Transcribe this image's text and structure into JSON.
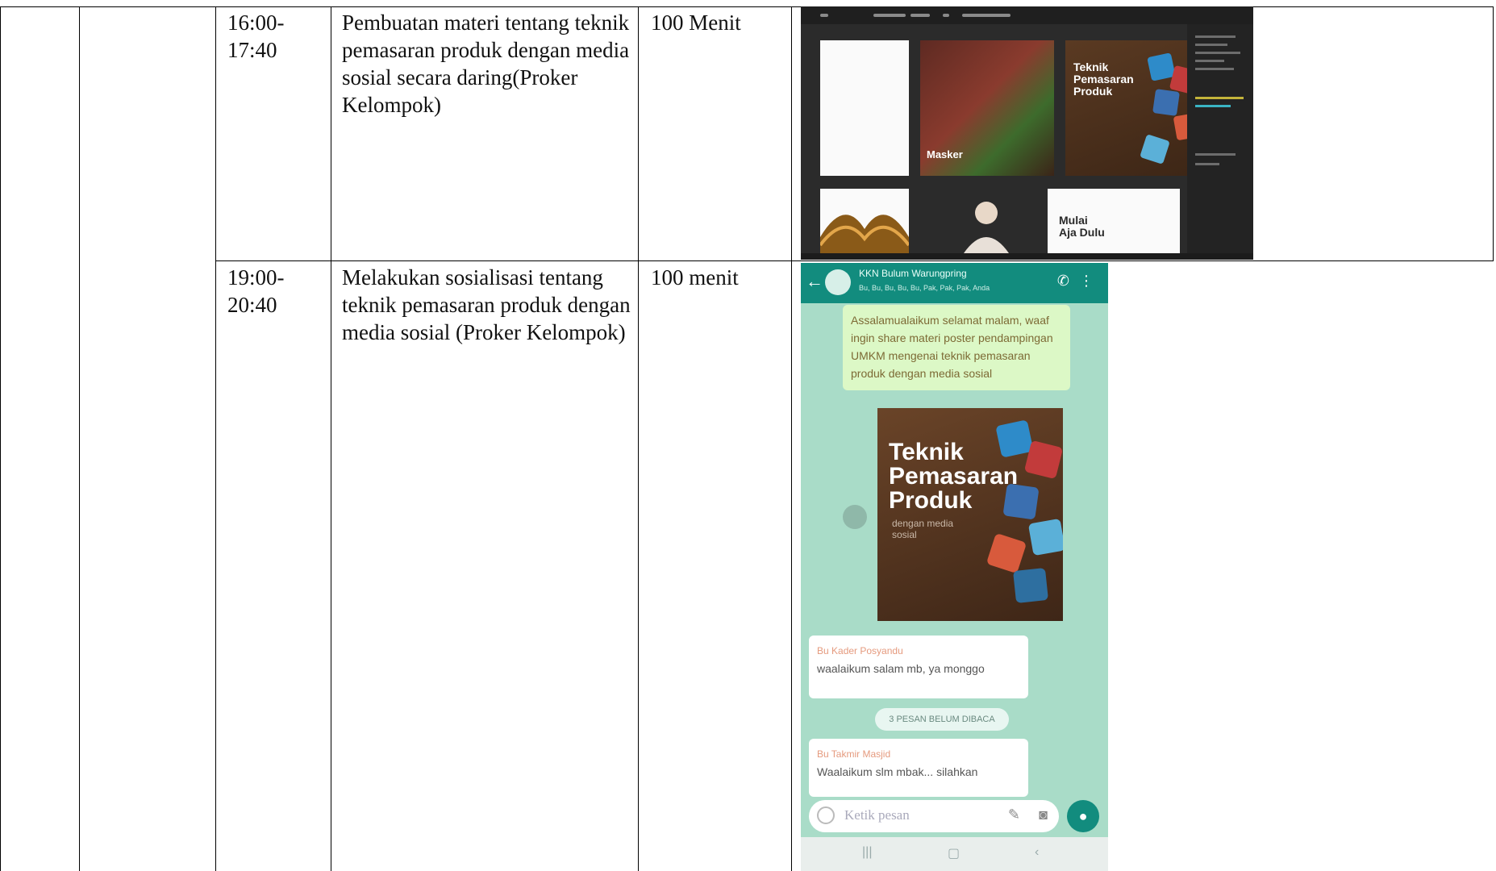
{
  "rows": [
    {
      "time": "16:00-\n17:40",
      "activity": "Pembuatan materi tentang teknik pemasaran produk dengan media sosial secara daring(Proker Kelompok)",
      "duration": "100 Menit",
      "image": {
        "poster_title": "Teknik\nPemasaran\nProduk",
        "masker_label": "Masker",
        "mulai_label": "Mulai\nAja Dulu"
      }
    },
    {
      "time": "19:00-\n20:40",
      "activity": "Melakukan sosialisasi tentang teknik pemasaran produk dengan media sosial (Proker Kelompok)",
      "duration": "100 menit",
      "image": {
        "group_name": "KKN Bulum Warungpring",
        "group_members": "Bu, Bu, Bu, Bu, Bu, Pak, Pak, Pak, Anda",
        "message_1": "Assalamualaikum selamat malam, waaf ingin share materi poster pendampingan UMKM mengenai teknik pemasaran produk dengan media sosial",
        "poster_title": "Teknik\nPemasaran\nProduk",
        "poster_sub": "dengan media\nsosial",
        "reply_1_sender": "Bu Kader Posyandu",
        "reply_1_text": "waalaikum salam mb, ya monggo",
        "unread_label": "3 PESAN BELUM DIBACA",
        "reply_2_sender": "Bu Takmir Masjid",
        "reply_2_text": "Waalaikum slm mbak... silahkan",
        "input_placeholder": "Ketik pesan"
      }
    }
  ],
  "colors": {
    "wa_header": "#128c7e",
    "wa_background": "#a9dcc8",
    "bubble_out": "#dcf8c6"
  }
}
